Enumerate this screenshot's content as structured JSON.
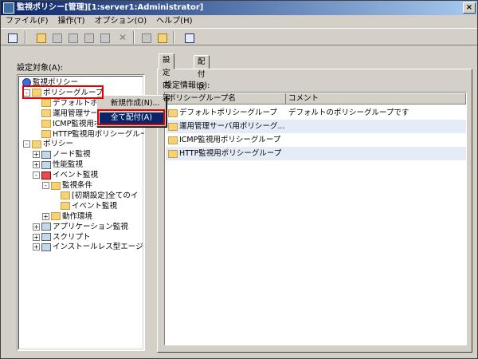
{
  "window": {
    "title": "監視ポリシー[管理][1:server1:Administrator]"
  },
  "menu": [
    "ファイル(F)",
    "操作(T)",
    "オプション(O)",
    "ヘルプ(H)"
  ],
  "left": {
    "label": "設定対象(A):",
    "tree": [
      {
        "label": "監視ポリシー",
        "indent": 0,
        "icon": "globe-icon"
      },
      {
        "label": "ポリシーグループ",
        "indent": 1,
        "icon": "folder-icon",
        "expand": "-"
      },
      {
        "label": "デフォルトポリシー...",
        "indent": 2,
        "icon": "policy-icon"
      },
      {
        "label": "運用管理サーバ...",
        "indent": 2,
        "icon": "policy-icon"
      },
      {
        "label": "ICMP監視用ポ...",
        "indent": 2,
        "icon": "policy-icon"
      },
      {
        "label": "HTTP監視用ポリシーグルー",
        "indent": 2,
        "icon": "policy-icon"
      },
      {
        "label": "ポリシー",
        "indent": 1,
        "icon": "folder-icon",
        "expand": "-"
      },
      {
        "label": "ノード監視",
        "indent": 2,
        "icon": "node-icon",
        "expand": "+"
      },
      {
        "label": "性能監視",
        "indent": 2,
        "icon": "perf-icon",
        "expand": "+"
      },
      {
        "label": "イベント監視",
        "indent": 2,
        "icon": "event-icon",
        "expand": "-"
      },
      {
        "label": "監視条件",
        "indent": 3,
        "icon": "folder-icon",
        "expand": "-"
      },
      {
        "label": "[初期設定]全てのイ",
        "indent": 4,
        "icon": "policy-icon"
      },
      {
        "label": "イベント監視",
        "indent": 4,
        "icon": "policy-icon"
      },
      {
        "label": "動作環境",
        "indent": 3,
        "icon": "folder-icon",
        "expand": "+"
      },
      {
        "label": "アプリケーション監視",
        "indent": 2,
        "icon": "app-icon",
        "expand": "+"
      },
      {
        "label": "スクリプト",
        "indent": 2,
        "icon": "script-icon",
        "expand": "+"
      },
      {
        "label": "インストールレス型エージ",
        "indent": 2,
        "icon": "agentless-icon",
        "expand": "+"
      }
    ]
  },
  "context_menu": {
    "items": [
      {
        "label": "新規作成(N)...",
        "selected": false
      },
      {
        "label": "全て配付(A)",
        "selected": true
      }
    ]
  },
  "tabs": [
    {
      "label": "設定内容",
      "active": true
    },
    {
      "label": "配付状況",
      "active": false
    }
  ],
  "right": {
    "label": "設定情報(S):",
    "columns": [
      "ポリシーグループ名",
      "コメント"
    ],
    "rows": [
      {
        "name": "デフォルトポリシーグループ",
        "comment": "デフォルトのポリシーグループです"
      },
      {
        "name": "運用管理サーバ用ポリシーグ...",
        "comment": ""
      },
      {
        "name": "ICMP監視用ポリシーグループ",
        "comment": ""
      },
      {
        "name": "HTTP監視用ポリシーグループ",
        "comment": ""
      }
    ]
  },
  "colors": {
    "selection": "#0a246a",
    "highlight_box": "#e00000",
    "row_alt": "#e6ecf7"
  }
}
